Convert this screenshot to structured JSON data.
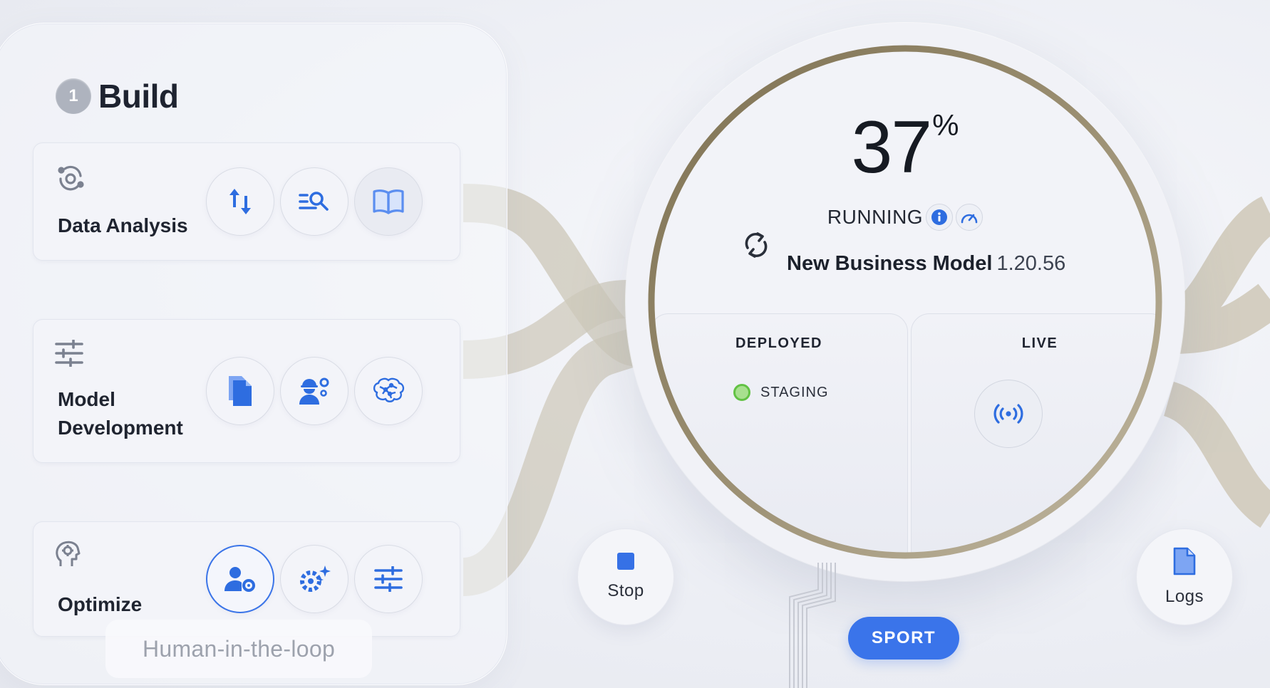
{
  "build": {
    "step_number": "1",
    "title": "Build"
  },
  "cards": [
    {
      "title": "Data Analysis",
      "icon": "orbit-icon",
      "tools": [
        "transfer-arrows-icon",
        "search-list-icon",
        "open-book-icon"
      ]
    },
    {
      "title_line1": "Model",
      "title_line2": "Development",
      "icon": "sliders-icon",
      "tools": [
        "documents-icon",
        "engineer-icon",
        "neural-brain-icon"
      ]
    },
    {
      "title": "Optimize",
      "icon": "head-gear-icon",
      "tools": [
        "user-settings-icon",
        "sparkle-gear-icon",
        "tune-sliders-icon"
      ]
    }
  ],
  "hitl_label": "Human-in-the-loop",
  "gauge": {
    "percent_value": "37",
    "percent_sign": "%",
    "progress_fraction": 0.37,
    "status": "RUNNING",
    "model_name": "New Business Model",
    "model_version": "1.20.56",
    "ring_color": "#8e8266"
  },
  "deployed": {
    "title": "DEPLOYED",
    "stage": "STAGING",
    "stage_color": "#62c244"
  },
  "live": {
    "title": "LIVE"
  },
  "actions": {
    "stop_label": "Stop",
    "logs_label": "Logs",
    "sport_label": "SPORT"
  },
  "colors": {
    "accent": "#3a74ea",
    "flow": "#c9c2b1",
    "background": "#eceef4"
  }
}
